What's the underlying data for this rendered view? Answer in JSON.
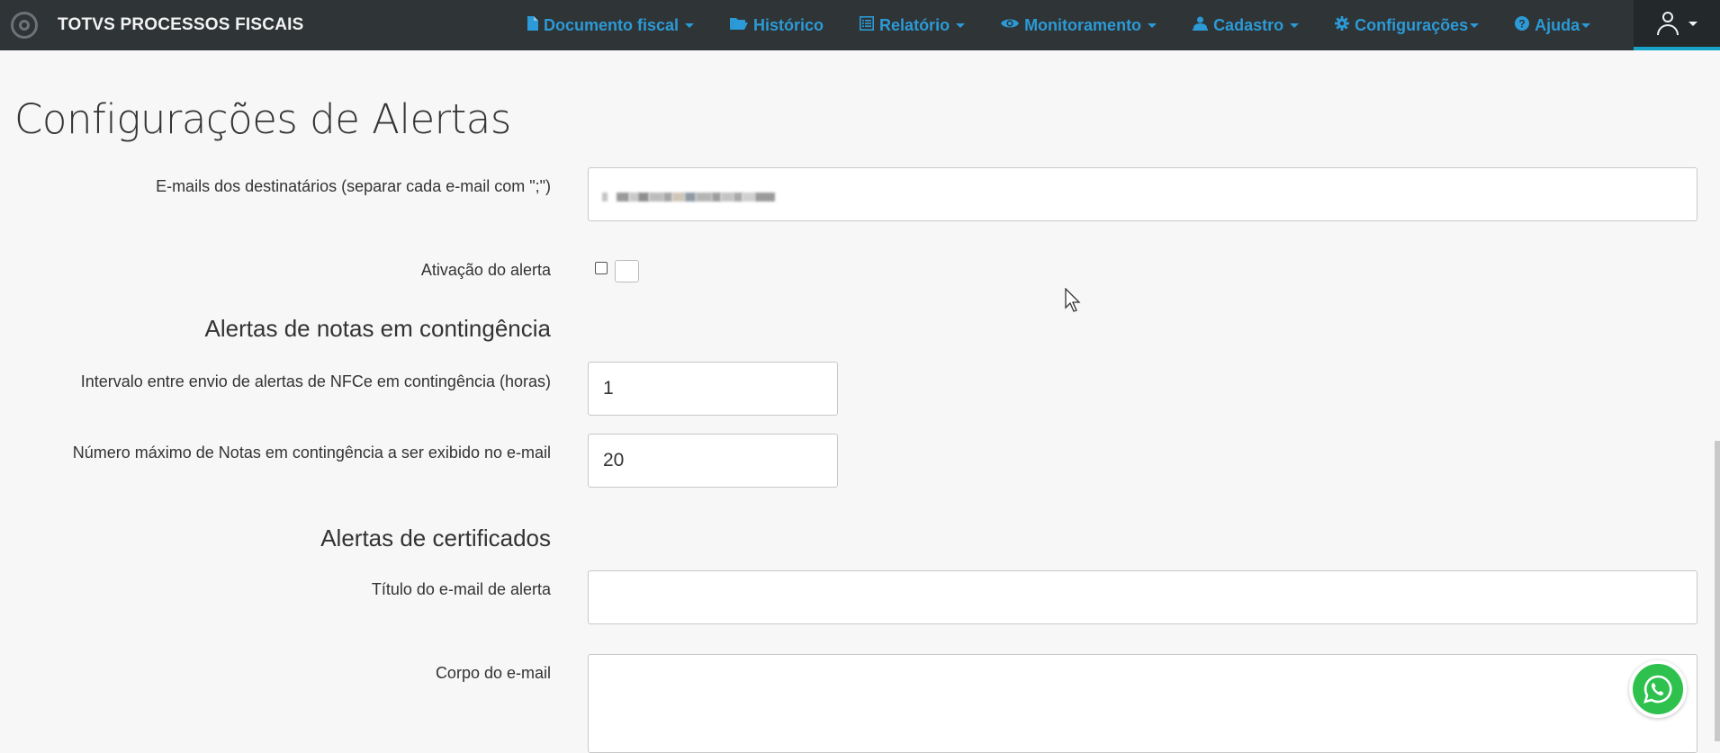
{
  "navbar": {
    "brand": "TOTVS PROCESSOS FISCAIS",
    "menu": [
      {
        "label": "Documento fiscal",
        "icon": "file-icon",
        "dropdown": true
      },
      {
        "label": "Histórico",
        "icon": "folder-open-icon",
        "dropdown": false
      },
      {
        "label": "Relatório",
        "icon": "list-alt-icon",
        "dropdown": true
      },
      {
        "label": "Monitoramento",
        "icon": "eye-icon",
        "dropdown": true
      },
      {
        "label": "Cadastro",
        "icon": "user-tie-icon",
        "dropdown": true
      },
      {
        "label": "Configurações",
        "icon": "gear-icon",
        "dropdown": true
      },
      {
        "label": "Ajuda",
        "icon": "question-circle-icon",
        "dropdown": true
      }
    ],
    "user_menu": {
      "icon": "user-icon",
      "dropdown": true
    }
  },
  "page": {
    "title": "Configurações de Alertas"
  },
  "form": {
    "emails": {
      "label": "E-mails dos destinatários (separar cada e-mail com \";\")",
      "value_blurred": true
    },
    "activation": {
      "label": "Ativação do alerta",
      "checked": false
    },
    "contingency_section": {
      "heading": "Alertas de notas em contingência",
      "interval": {
        "label": "Intervalo entre envio de alertas de NFCe em contingência (horas)",
        "value": "1"
      },
      "max_notes": {
        "label": "Número máximo de Notas em contingência a ser exibido no e-mail",
        "value": "20"
      }
    },
    "certificates_section": {
      "heading": "Alertas de certificados",
      "email_title": {
        "label": "Título do e-mail de alerta",
        "value": ""
      },
      "email_body": {
        "label": "Corpo do e-mail",
        "value": ""
      }
    }
  },
  "widgets": {
    "whatsapp_icon": "whatsapp-icon"
  },
  "colors": {
    "navbar_bg": "#2f3436",
    "menu_link": "#2b9ad6",
    "active_underline": "#17a2c9",
    "page_bg": "#f7f7f7",
    "whatsapp_green": "#2fc14e"
  }
}
